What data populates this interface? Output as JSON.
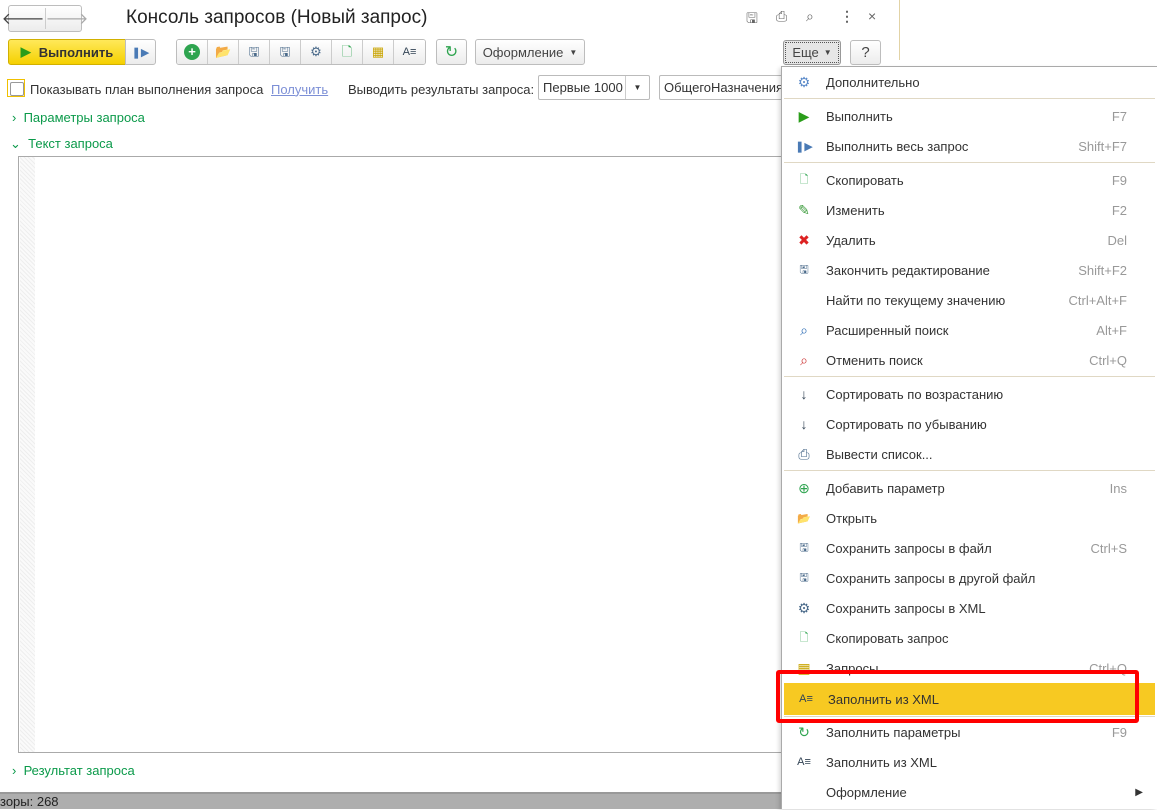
{
  "window": {
    "title": "Консоль запросов (Новый запрос)"
  },
  "toolbar": {
    "run_label": "Выполнить",
    "design_label": "Оформление",
    "more_label": "Еще",
    "help_label": "?"
  },
  "options": {
    "show_plan_label": "Показывать план выполнения запроса",
    "get_link": "Получить",
    "output_label": "Выводить результаты запроса:",
    "output_value": "Первые 1000",
    "mode_value": "ОбщегоНазначения"
  },
  "sections": {
    "params": "Параметры запроса",
    "text": "Текст запроса",
    "result": "Результат запроса"
  },
  "status": {
    "text": "зоры: 268"
  },
  "menu": {
    "items": [
      {
        "label": "Дополнительно",
        "shortcut": "",
        "icon": "gear-db-icon"
      },
      {
        "label": "Выполнить",
        "shortcut": "F7",
        "icon": "play-icon"
      },
      {
        "label": "Выполнить весь запрос",
        "shortcut": "Shift+F7",
        "icon": "run-all-icon"
      },
      {
        "label": "Скопировать",
        "shortcut": "F9",
        "icon": "copy-icon"
      },
      {
        "label": "Изменить",
        "shortcut": "F2",
        "icon": "pencil-icon"
      },
      {
        "label": "Удалить",
        "shortcut": "Del",
        "icon": "delete-icon"
      },
      {
        "label": "Закончить редактирование",
        "shortcut": "Shift+F2",
        "icon": "save-ok-icon"
      },
      {
        "label": "Найти по текущему значению",
        "shortcut": "Ctrl+Alt+F",
        "icon": ""
      },
      {
        "label": "Расширенный поиск",
        "shortcut": "Alt+F",
        "icon": "search-icon"
      },
      {
        "label": "Отменить поиск",
        "shortcut": "Ctrl+Q",
        "icon": "cancel-search-icon"
      },
      {
        "label": "Сортировать по возрастанию",
        "shortcut": "",
        "icon": "sort-asc-icon"
      },
      {
        "label": "Сортировать по убыванию",
        "shortcut": "",
        "icon": "sort-desc-icon"
      },
      {
        "label": "Вывести список...",
        "shortcut": "",
        "icon": "print-list-icon"
      },
      {
        "label": "Добавить параметр",
        "shortcut": "Ins",
        "icon": "add-icon"
      },
      {
        "label": "Открыть",
        "shortcut": "",
        "icon": "open-folder-icon"
      },
      {
        "label": "Сохранить запросы в файл",
        "shortcut": "Ctrl+S",
        "icon": "save-icon"
      },
      {
        "label": "Сохранить запросы в другой файл",
        "shortcut": "",
        "icon": "save-as-icon"
      },
      {
        "label": "Сохранить запросы в XML",
        "shortcut": "",
        "icon": "save-xml-icon"
      },
      {
        "label": "Скопировать запрос",
        "shortcut": "",
        "icon": "copy-query-icon"
      },
      {
        "label": "Запросы",
        "shortcut": "Ctrl+Q",
        "icon": "table-icon"
      },
      {
        "label": "Заполнить из XML",
        "shortcut": "",
        "icon": "xml-doc-icon"
      },
      {
        "label": "Заполнить параметры",
        "shortcut": "F9",
        "icon": "refresh-icon"
      },
      {
        "label": "Заполнить из XML",
        "shortcut": "",
        "icon": "xml-doc-icon"
      },
      {
        "label": "Оформление",
        "shortcut": "",
        "icon": ""
      }
    ]
  },
  "colors": {
    "accent": "#f7c922",
    "green": "#0b9a4a",
    "highlight_border": "#ff0000"
  }
}
